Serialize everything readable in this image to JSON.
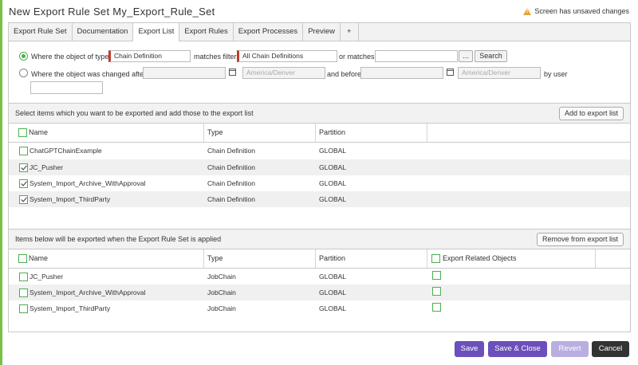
{
  "header": {
    "title": "New Export Rule Set My_Export_Rule_Set",
    "unsaved_text": "Screen has unsaved changes"
  },
  "tabs": [
    {
      "label": "Export Rule Set"
    },
    {
      "label": "Documentation"
    },
    {
      "label": "Export List"
    },
    {
      "label": "Export Rules"
    },
    {
      "label": "Export Processes"
    },
    {
      "label": "Preview"
    },
    {
      "label": "+"
    }
  ],
  "filter": {
    "type_label": "Where the object of type",
    "type_value": "Chain Definition",
    "matches_filter_label": "matches filter",
    "filter_value": "All Chain Definitions",
    "or_matches_label": "or matches",
    "or_matches_value": "",
    "ellipsis_label": "...",
    "search_label": "Search",
    "changed_label": "Where the object was changed after",
    "after_value": "",
    "after_tz_placeholder": "America/Denver",
    "and_before_label": "and before",
    "before_value": "",
    "before_tz_placeholder": "America/Denver",
    "by_user_label": "by user",
    "user_value": ""
  },
  "select_section": {
    "text": "Select items which you want to be exported and add those to the export list",
    "button_label": "Add to export list",
    "columns": [
      "Name",
      "Type",
      "Partition"
    ],
    "rows": [
      {
        "checked": false,
        "name": "ChatGPTChainExample",
        "type": "Chain Definition",
        "partition": "GLOBAL"
      },
      {
        "checked": true,
        "name": "JC_Pusher",
        "type": "Chain Definition",
        "partition": "GLOBAL"
      },
      {
        "checked": true,
        "name": "System_Import_Archive_WithApproval",
        "type": "Chain Definition",
        "partition": "GLOBAL"
      },
      {
        "checked": true,
        "name": "System_Import_ThirdParty",
        "type": "Chain Definition",
        "partition": "GLOBAL"
      }
    ]
  },
  "export_section": {
    "text": "Items below will be exported when the Export Rule Set is applied",
    "button_label": "Remove from export list",
    "columns": [
      "Name",
      "Type",
      "Partition",
      "Export Related Objects"
    ],
    "rows": [
      {
        "checked": false,
        "name": "JC_Pusher",
        "type": "JobChain",
        "partition": "GLOBAL",
        "related": false
      },
      {
        "checked": false,
        "name": "System_Import_Archive_WithApproval",
        "type": "JobChain",
        "partition": "GLOBAL",
        "related": false
      },
      {
        "checked": false,
        "name": "System_Import_ThirdParty",
        "type": "JobChain",
        "partition": "GLOBAL",
        "related": false
      }
    ]
  },
  "footer": {
    "save_label": "Save",
    "save_close_label": "Save & Close",
    "revert_label": "Revert",
    "cancel_label": "Cancel"
  },
  "colors": {
    "primary": "#6b4fbb",
    "primary_disabled": "#b9aee0",
    "dark": "#333333",
    "accent_green": "#4caf50",
    "warning": "#e8a33d",
    "required_red": "#c0392b"
  }
}
